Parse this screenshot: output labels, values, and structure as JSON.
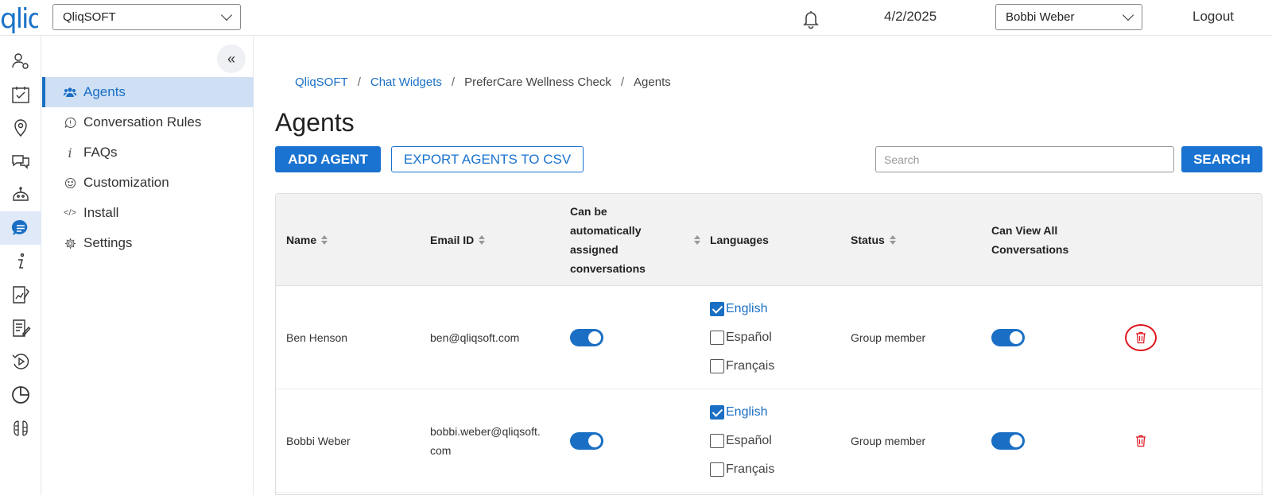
{
  "brand": {
    "logo_text": "qliq",
    "accent": "#1a73d0"
  },
  "header": {
    "org_select": {
      "value": "QliqSOFT"
    },
    "date": "4/2/2025",
    "user_select": {
      "value": "Bobbi Weber"
    },
    "logout_label": "Logout",
    "bell_icon": "bell-icon"
  },
  "rail": {
    "items": [
      {
        "icon": "user-gear-icon",
        "active": false
      },
      {
        "icon": "calendar-check-icon",
        "active": false
      },
      {
        "icon": "map-pin-icon",
        "active": false
      },
      {
        "icon": "chat-bubbles-icon",
        "active": false
      },
      {
        "icon": "robot-icon",
        "active": false
      },
      {
        "icon": "chat-widget-icon",
        "active": true
      },
      {
        "icon": "info-icon",
        "active": false
      },
      {
        "icon": "document-chart-icon",
        "active": false
      },
      {
        "icon": "document-edit-icon",
        "active": false
      },
      {
        "icon": "history-icon",
        "active": false
      },
      {
        "icon": "pie-chart-icon",
        "active": false
      },
      {
        "icon": "ai-brain-icon",
        "active": false
      }
    ]
  },
  "sidenav": {
    "collapse_icon": "double-chevron-left-icon",
    "items": [
      {
        "label": "Agents",
        "icon": "users-icon",
        "active": true
      },
      {
        "label": "Conversation Rules",
        "icon": "rules-icon",
        "active": false
      },
      {
        "label": "FAQs",
        "icon": "info-icon",
        "active": false
      },
      {
        "label": "Customization",
        "icon": "smile-icon",
        "active": false
      },
      {
        "label": "Install",
        "icon": "code-icon",
        "active": false
      },
      {
        "label": "Settings",
        "icon": "gear-icon",
        "active": false
      }
    ]
  },
  "breadcrumb": {
    "items": [
      {
        "label": "QliqSOFT",
        "link": true
      },
      {
        "label": "Chat Widgets",
        "link": true
      },
      {
        "label": "PreferCare Wellness Check",
        "link": false
      },
      {
        "label": "Agents",
        "link": false
      }
    ],
    "separator": "/"
  },
  "page": {
    "title": "Agents",
    "add_label": "ADD AGENT",
    "export_label": "EXPORT AGENTS TO CSV",
    "search_placeholder": "Search",
    "search_value": "",
    "search_label": "SEARCH"
  },
  "table": {
    "columns": {
      "name": "Name",
      "email": "Email ID",
      "auto_assign": [
        "Can be",
        "automatically",
        "assigned",
        "conversations"
      ],
      "languages": "Languages",
      "status": "Status",
      "view_all": [
        "Can View All",
        "Conversations"
      ]
    },
    "rows": [
      {
        "name": "Ben Henson",
        "email": [
          "ben@qliqsoft.com"
        ],
        "auto_assign": true,
        "languages": [
          {
            "label": "English",
            "checked": true
          },
          {
            "label": "Español",
            "checked": false
          },
          {
            "label": "Français",
            "checked": false
          }
        ],
        "status": "Group member",
        "view_all": true,
        "delete_highlighted": true
      },
      {
        "name": "Bobbi Weber",
        "email": [
          "bobbi.weber@qliqsoft.",
          "com"
        ],
        "auto_assign": true,
        "languages": [
          {
            "label": "English",
            "checked": true
          },
          {
            "label": "Español",
            "checked": false
          },
          {
            "label": "Français",
            "checked": false
          }
        ],
        "status": "Group member",
        "view_all": true,
        "delete_highlighted": false
      }
    ]
  }
}
